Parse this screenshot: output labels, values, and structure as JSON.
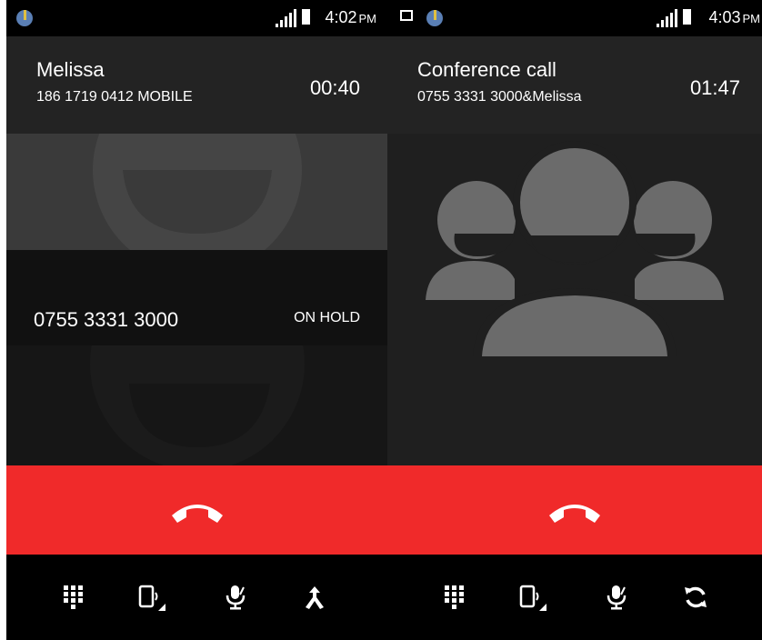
{
  "left_screen": {
    "status_bar": {
      "time": "4:02",
      "ampm": "PM"
    },
    "active_call": {
      "name": "Melissa",
      "number_line": "186 1719 0412  MOBILE",
      "timer": "00:40"
    },
    "held_call": {
      "number": "0755 3331 3000",
      "status": "ON HOLD"
    },
    "controls": [
      "dialpad-icon",
      "speaker-icon",
      "mute-icon",
      "merge-call-icon"
    ]
  },
  "right_screen": {
    "status_bar": {
      "time": "4:03",
      "ampm": "PM"
    },
    "active_call": {
      "name": "Conference call",
      "number_line": "0755 3331 3000&Melissa",
      "timer": "01:47"
    },
    "controls": [
      "dialpad-icon",
      "speaker-icon",
      "mute-icon",
      "swap-call-icon"
    ]
  },
  "colors": {
    "end_call": "#f02a2a",
    "background": "#1f1f1f",
    "avatar": "#6b6b6b"
  }
}
